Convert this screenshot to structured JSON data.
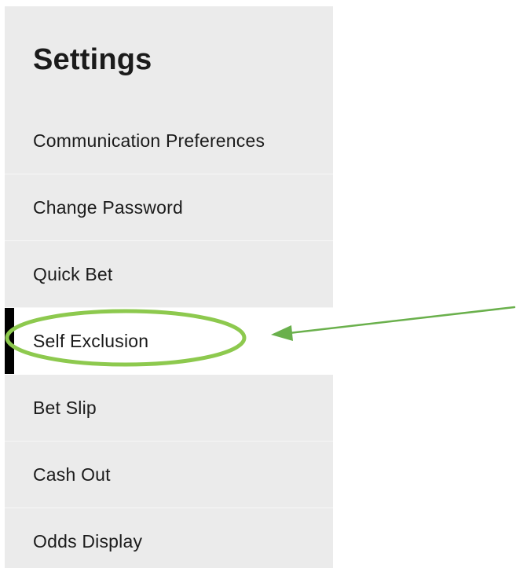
{
  "settings": {
    "title": "Settings",
    "items": [
      {
        "label": "Communication Preferences",
        "active": false
      },
      {
        "label": "Change Password",
        "active": false
      },
      {
        "label": "Quick Bet",
        "active": false
      },
      {
        "label": "Self Exclusion",
        "active": true
      },
      {
        "label": "Bet Slip",
        "active": false
      },
      {
        "label": "Cash Out",
        "active": false
      },
      {
        "label": "Odds Display",
        "active": false
      }
    ]
  },
  "annotation": {
    "color": "#8dc94e",
    "highlighted_item": "Self Exclusion"
  }
}
